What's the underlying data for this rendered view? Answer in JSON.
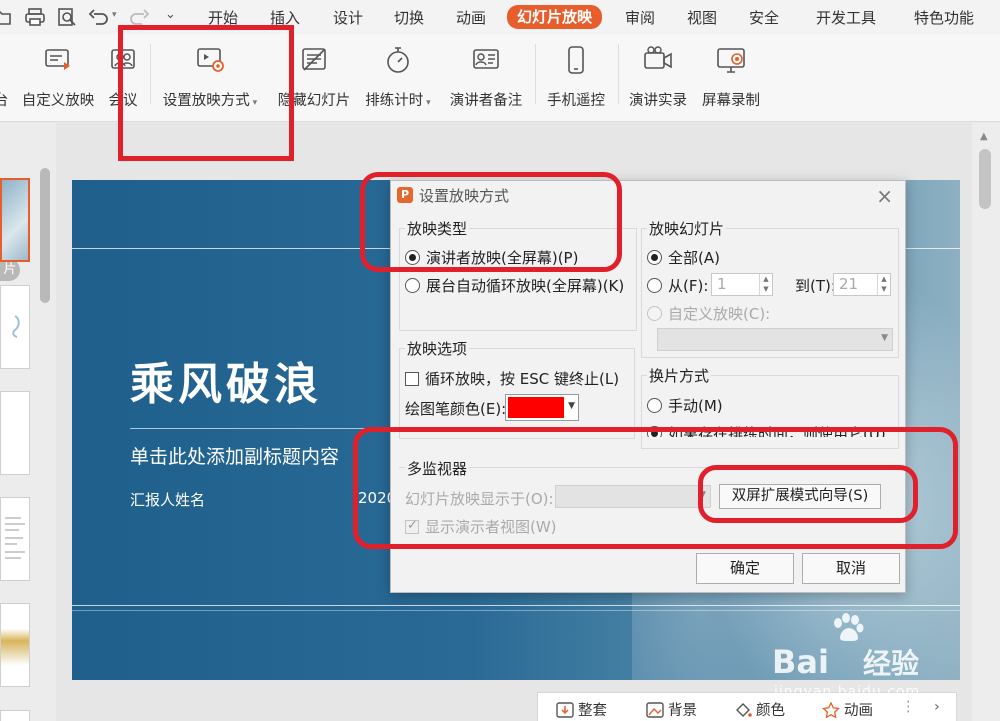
{
  "menu": {
    "items": [
      "开始",
      "插入",
      "设计",
      "切换",
      "动画",
      "幻灯片放映",
      "审阅",
      "视图",
      "安全",
      "开发工具",
      "特色功能"
    ],
    "active_index": 5
  },
  "ribbon": {
    "partial_left": "台",
    "custom_show": "自定义放映",
    "meeting": "会议",
    "setup_show": "设置放映方式",
    "hide_slide": "隐藏幻灯片",
    "rehearse": "排练计时",
    "speaker_notes": "演讲者备注",
    "phone_remote": "手机遥控",
    "record_speech": "演讲实录",
    "screen_record": "屏幕录制"
  },
  "left_pane": {
    "tab_label": "片"
  },
  "slide": {
    "title": "乘风破浪",
    "subtitle": "单击此处添加副标题内容",
    "author": "汇报人姓名",
    "date_partial": "2020"
  },
  "bottom_bar": {
    "set": "整套",
    "background": "背景",
    "color": "颜色",
    "animation": "动画"
  },
  "dialog": {
    "title": "设置放映方式",
    "show_type": {
      "label": "放映类型",
      "presenter": "演讲者放映(全屏幕)(P)",
      "kiosk": "展台自动循环放映(全屏幕)(K)"
    },
    "show_slides": {
      "label": "放映幻灯片",
      "all": "全部(A)",
      "from": "从(F):",
      "from_value": "1",
      "to": "到(T):",
      "to_value": "21",
      "custom": "自定义放映(C):"
    },
    "show_options": {
      "label": "放映选项",
      "loop": "循环放映，按 ESC 键终止(L)",
      "pen_color": "绘图笔颜色(E):"
    },
    "advance": {
      "label": "换片方式",
      "manual": "手动(M)",
      "timings": "如果存在排练时间，则使用它(U)"
    },
    "monitors": {
      "label": "多监视器",
      "display_on": "幻灯片放映显示于(O):",
      "dual_screen_btn": "双屏扩展模式向导(S)",
      "presenter_view": "显示演示者视图(W)"
    },
    "ok": "确定",
    "cancel": "取消"
  },
  "watermark": {
    "brand": "Bai",
    "brand_cn": "经验",
    "url": "jingyan.baidu.com"
  },
  "colors": {
    "accent": "#e85d2c",
    "annotation": "#e0202b",
    "pen_color": "#ff0000",
    "slide_blue": "#1f5f8c"
  }
}
